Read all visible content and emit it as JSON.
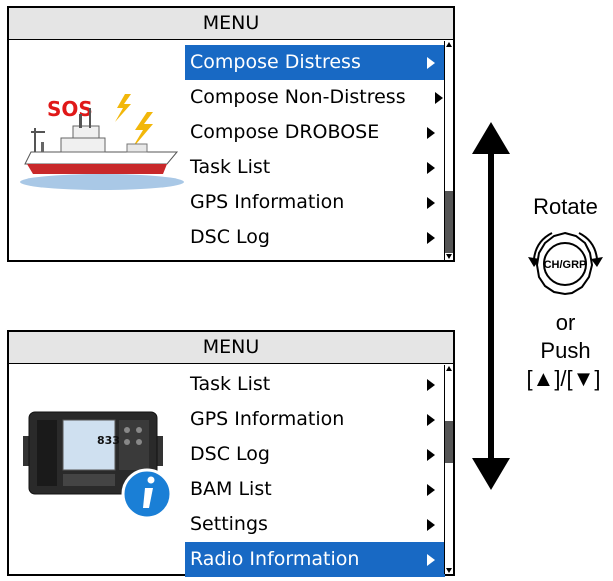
{
  "top_menu": {
    "title": "MENU",
    "items": [
      {
        "label": "Compose Distress",
        "selected": true
      },
      {
        "label": "Compose Non-Distress",
        "selected": false
      },
      {
        "label": "Compose DROBOSE",
        "selected": false
      },
      {
        "label": "Task List",
        "selected": false
      },
      {
        "label": "GPS Information",
        "selected": false
      },
      {
        "label": "DSC Log",
        "selected": false
      }
    ],
    "illustration_text": "SOS"
  },
  "bottom_menu": {
    "title": "MENU",
    "items": [
      {
        "label": "Task List",
        "selected": false
      },
      {
        "label": "GPS Information",
        "selected": false
      },
      {
        "label": "DSC Log",
        "selected": false
      },
      {
        "label": "BAM List",
        "selected": false
      },
      {
        "label": "Settings",
        "selected": false
      },
      {
        "label": "Radio Information",
        "selected": true
      }
    ],
    "radio_display_text": "833"
  },
  "instructions": {
    "rotate_label": "Rotate",
    "knob_label": "CH/GRP",
    "or_label": "or",
    "push_label": "Push",
    "keys_label": "[▲]/[▼]"
  },
  "colors": {
    "selection": "#1869c4",
    "sos_text": "#e01818",
    "ship_hull": "#c8282a",
    "info_badge": "#1a7fd6"
  }
}
